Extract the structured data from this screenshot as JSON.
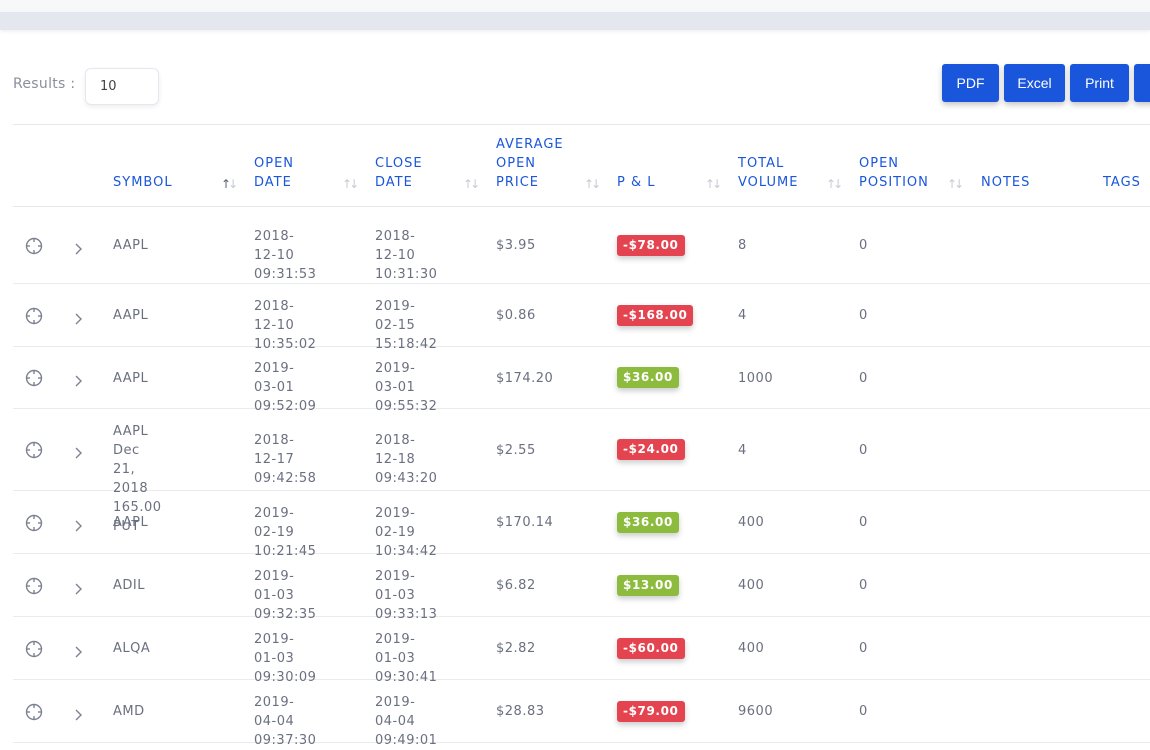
{
  "toolbar": {
    "results_label": "Results :",
    "results_value": "10",
    "buttons": [
      "PDF",
      "Excel",
      "Print"
    ]
  },
  "table": {
    "headers": {
      "symbol": "SYMBOL",
      "open_date": [
        "OPEN",
        "DATE"
      ],
      "close_date": [
        "CLOSE",
        "DATE"
      ],
      "avg_open_price": [
        "AVERAGE",
        "OPEN",
        "PRICE"
      ],
      "pnl": "P & L",
      "total_volume": [
        "TOTAL",
        "VOLUME"
      ],
      "open_position": [
        "OPEN",
        "POSITION"
      ],
      "notes": "NOTES",
      "tags": "TAGS"
    },
    "rows": [
      {
        "symbol": [
          "AAPL"
        ],
        "open": [
          "2018-12-10",
          "09:31:53"
        ],
        "close": [
          "2018-12-10",
          "10:31:30"
        ],
        "price": "$3.95",
        "pnl": "-$78.00",
        "pnl_sign": "neg",
        "volume": "8",
        "position": "0"
      },
      {
        "symbol": [
          "AAPL"
        ],
        "open": [
          "2018-12-10",
          "10:35:02"
        ],
        "close": [
          "2019-02-15",
          "15:18:42"
        ],
        "price": "$0.86",
        "pnl": "-$168.00",
        "pnl_sign": "neg",
        "volume": "4",
        "position": "0"
      },
      {
        "symbol": [
          "AAPL"
        ],
        "open": [
          "2019-03-01",
          "09:52:09"
        ],
        "close": [
          "2019-03-01",
          "09:55:32"
        ],
        "price": "$174.20",
        "pnl": "$36.00",
        "pnl_sign": "pos",
        "volume": "1000",
        "position": "0"
      },
      {
        "symbol": [
          "AAPL Dec 21,",
          "2018 165.00",
          "PUT"
        ],
        "open": [
          "2018-12-17",
          "09:42:58"
        ],
        "close": [
          "2018-12-18",
          "09:43:20"
        ],
        "price": "$2.55",
        "pnl": "-$24.00",
        "pnl_sign": "neg",
        "volume": "4",
        "position": "0"
      },
      {
        "symbol": [
          "AAPL"
        ],
        "open": [
          "2019-02-19",
          "10:21:45"
        ],
        "close": [
          "2019-02-19",
          "10:34:42"
        ],
        "price": "$170.14",
        "pnl": "$36.00",
        "pnl_sign": "pos",
        "volume": "400",
        "position": "0"
      },
      {
        "symbol": [
          "ADIL"
        ],
        "open": [
          "2019-01-03",
          "09:32:35"
        ],
        "close": [
          "2019-01-03",
          "09:33:13"
        ],
        "price": "$6.82",
        "pnl": "$13.00",
        "pnl_sign": "pos",
        "volume": "400",
        "position": "0"
      },
      {
        "symbol": [
          "ALQA"
        ],
        "open": [
          "2019-01-03",
          "09:30:09"
        ],
        "close": [
          "2019-01-03",
          "09:30:41"
        ],
        "price": "$2.82",
        "pnl": "-$60.00",
        "pnl_sign": "neg",
        "volume": "400",
        "position": "0"
      },
      {
        "symbol": [
          "AMD"
        ],
        "open": [
          "2019-04-04",
          "09:37:30"
        ],
        "close": [
          "2019-04-04",
          "09:49:01"
        ],
        "price": "$28.83",
        "pnl": "-$79.00",
        "pnl_sign": "neg",
        "volume": "9600",
        "position": "0"
      }
    ]
  },
  "icons": {
    "row_select": "crosshair-target-icon",
    "row_expand": "chevron-right-icon",
    "sort": "sort-arrows-icon"
  },
  "colors": {
    "accent": "#1a56db",
    "loss": "#e3444f",
    "gain": "#8cbb3d"
  }
}
